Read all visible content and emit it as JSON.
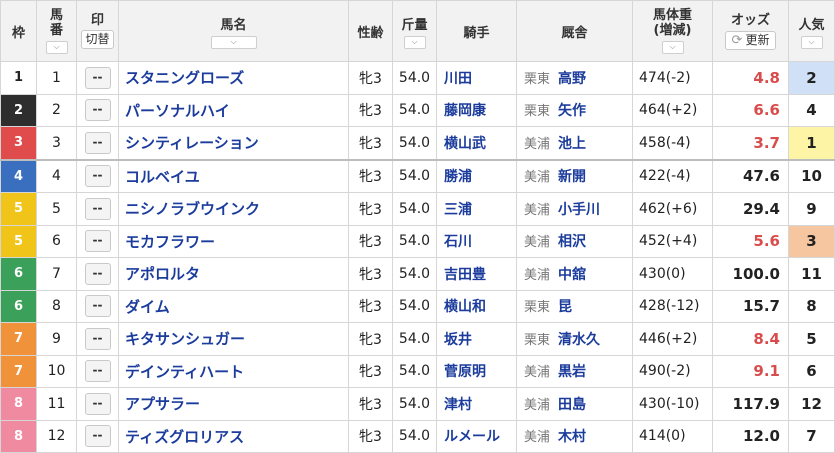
{
  "headers": {
    "waku": "枠",
    "umaban_top": "馬",
    "umaban_bottom": "番",
    "mark": "印",
    "mark_button": "切替",
    "horse": "馬名",
    "sexage": "性齢",
    "weight": "斤量",
    "jockey": "騎手",
    "stable": "厩舎",
    "bodyweight_top": "馬体重",
    "bodyweight_bottom": "(増減)",
    "odds": "オッズ",
    "refresh_button": "更新",
    "popularity": "人気",
    "sort_icon": "chevron-down-icon"
  },
  "colors": {
    "waku": {
      "1": {
        "bg": "#ffffff",
        "fg": "#222222"
      },
      "2": {
        "bg": "#2e2e2e",
        "fg": "#ffffff"
      },
      "3": {
        "bg": "#e04b4b",
        "fg": "#ffffff"
      },
      "4": {
        "bg": "#3a6fc0",
        "fg": "#ffffff"
      },
      "5": {
        "bg": "#f0c419",
        "fg": "#ffffff"
      },
      "6": {
        "bg": "#3aa05a",
        "fg": "#ffffff"
      },
      "7": {
        "bg": "#f0923a",
        "fg": "#ffffff"
      },
      "8": {
        "bg": "#f08aa0",
        "fg": "#ffffff"
      }
    },
    "pop": {
      "1": "#fdf4a6",
      "2": "#cfe0f7",
      "3": "#f6c6a0"
    },
    "odds_low": "#d94c4c"
  },
  "rows": [
    {
      "waku": "1",
      "umaban": "1",
      "mark": "--",
      "horse": "スタニングローズ",
      "sexage": "牝3",
      "weight": "54.0",
      "jockey": "川田",
      "region": "栗東",
      "trainer": "高野",
      "bodyweight": "474(-2)",
      "odds": "4.8",
      "odds_low": true,
      "pop": "2"
    },
    {
      "waku": "2",
      "umaban": "2",
      "mark": "--",
      "horse": "パーソナルハイ",
      "sexage": "牝3",
      "weight": "54.0",
      "jockey": "藤岡康",
      "region": "栗東",
      "trainer": "矢作",
      "bodyweight": "464(+2)",
      "odds": "6.6",
      "odds_low": true,
      "pop": "4"
    },
    {
      "waku": "3",
      "umaban": "3",
      "mark": "--",
      "horse": "シンティレーション",
      "sexage": "牝3",
      "weight": "54.0",
      "jockey": "横山武",
      "region": "美浦",
      "trainer": "池上",
      "bodyweight": "458(-4)",
      "odds": "3.7",
      "odds_low": true,
      "pop": "1"
    },
    {
      "waku": "4",
      "umaban": "4",
      "mark": "--",
      "horse": "コルベイユ",
      "sexage": "牝3",
      "weight": "54.0",
      "jockey": "勝浦",
      "region": "美浦",
      "trainer": "新開",
      "bodyweight": "422(-4)",
      "odds": "47.6",
      "odds_low": false,
      "pop": "10"
    },
    {
      "waku": "5",
      "umaban": "5",
      "mark": "--",
      "horse": "ニシノラブウインク",
      "sexage": "牝3",
      "weight": "54.0",
      "jockey": "三浦",
      "region": "美浦",
      "trainer": "小手川",
      "bodyweight": "462(+6)",
      "odds": "29.4",
      "odds_low": false,
      "pop": "9"
    },
    {
      "waku": "5",
      "umaban": "6",
      "mark": "--",
      "horse": "モカフラワー",
      "sexage": "牝3",
      "weight": "54.0",
      "jockey": "石川",
      "region": "美浦",
      "trainer": "相沢",
      "bodyweight": "452(+4)",
      "odds": "5.6",
      "odds_low": true,
      "pop": "3"
    },
    {
      "waku": "6",
      "umaban": "7",
      "mark": "--",
      "horse": "アポロルタ",
      "sexage": "牝3",
      "weight": "54.0",
      "jockey": "吉田豊",
      "region": "美浦",
      "trainer": "中舘",
      "bodyweight": "430(0)",
      "odds": "100.0",
      "odds_low": false,
      "pop": "11"
    },
    {
      "waku": "6",
      "umaban": "8",
      "mark": "--",
      "horse": "ダイム",
      "sexage": "牝3",
      "weight": "54.0",
      "jockey": "横山和",
      "region": "栗東",
      "trainer": "昆",
      "bodyweight": "428(-12)",
      "odds": "15.7",
      "odds_low": false,
      "pop": "8"
    },
    {
      "waku": "7",
      "umaban": "9",
      "mark": "--",
      "horse": "キタサンシュガー",
      "sexage": "牝3",
      "weight": "54.0",
      "jockey": "坂井",
      "region": "栗東",
      "trainer": "清水久",
      "bodyweight": "446(+2)",
      "odds": "8.4",
      "odds_low": true,
      "pop": "5"
    },
    {
      "waku": "7",
      "umaban": "10",
      "mark": "--",
      "horse": "デインティハート",
      "sexage": "牝3",
      "weight": "54.0",
      "jockey": "菅原明",
      "region": "美浦",
      "trainer": "黒岩",
      "bodyweight": "490(-2)",
      "odds": "9.1",
      "odds_low": true,
      "pop": "6"
    },
    {
      "waku": "8",
      "umaban": "11",
      "mark": "--",
      "horse": "アプサラー",
      "sexage": "牝3",
      "weight": "54.0",
      "jockey": "津村",
      "region": "美浦",
      "trainer": "田島",
      "bodyweight": "430(-10)",
      "odds": "117.9",
      "odds_low": false,
      "pop": "12"
    },
    {
      "waku": "8",
      "umaban": "12",
      "mark": "--",
      "horse": "ティズグロリアス",
      "sexage": "牝3",
      "weight": "54.0",
      "jockey": "ルメール",
      "region": "美浦",
      "trainer": "木村",
      "bodyweight": "414(0)",
      "odds": "12.0",
      "odds_low": false,
      "pop": "7"
    }
  ]
}
